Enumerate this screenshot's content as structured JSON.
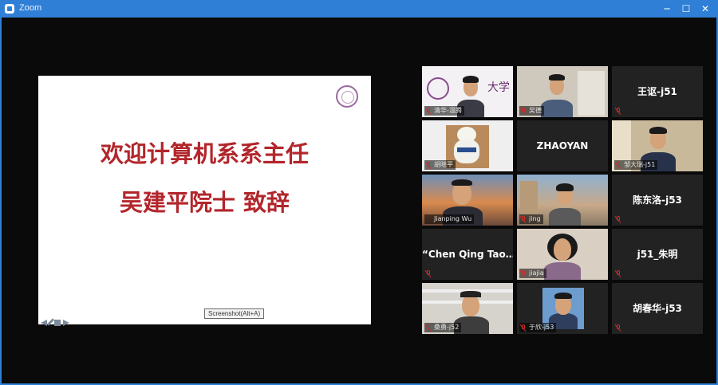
{
  "window": {
    "title": "Zoom"
  },
  "titlebar": {
    "minimize_label": "─",
    "maximize_label": "☐",
    "close_label": "✕"
  },
  "share": {
    "line1": "欢迎计算机系系主任",
    "line2": "吴建平院士  致辞",
    "tooltip": "Screenshot(Alt+A)"
  },
  "participants": [
    {
      "name": "清华-温腾",
      "video": true
    },
    {
      "name": "吴德",
      "video": true
    },
    {
      "name": "王讴-j51",
      "video": false
    },
    {
      "name": "胡晓平",
      "video": true
    },
    {
      "name": "ZHAOYAN",
      "video": false
    },
    {
      "name": "邹大瑞-j51",
      "video": true
    },
    {
      "name": "Jianping Wu",
      "video": true,
      "active": true
    },
    {
      "name": "jing",
      "video": true
    },
    {
      "name": "陈东洛-j53",
      "video": false
    },
    {
      "name": "“Chen Qing Tao…",
      "video": false
    },
    {
      "name": "jiajia",
      "video": true
    },
    {
      "name": "j51_朱明",
      "video": false
    },
    {
      "name": "桑勇-j52",
      "video": true
    },
    {
      "name": "于欣-j53",
      "video": true
    },
    {
      "name": "胡春华-j53",
      "video": false
    }
  ],
  "colors": {
    "accent": "#2f7fd6",
    "slide_text": "#b2262b",
    "active_speaker": "#e6da3c",
    "muted": "#d12b2b"
  }
}
